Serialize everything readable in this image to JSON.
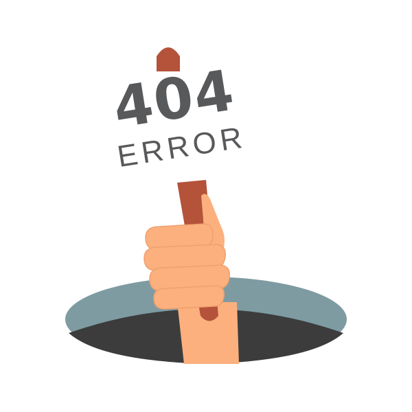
{
  "sign": {
    "code": "404",
    "label": "ERROR"
  },
  "colors": {
    "background": "#ffffff",
    "text": "#58595b",
    "stick": "#b4523a",
    "skin": "#fbb07e",
    "skin_shadow": "#f0a06e",
    "hole_rim": "#7e9ba2",
    "hole_inner": "#3c3c3c"
  },
  "icons": [
    "hand-holding-sign-illustration",
    "manhole-icon"
  ]
}
